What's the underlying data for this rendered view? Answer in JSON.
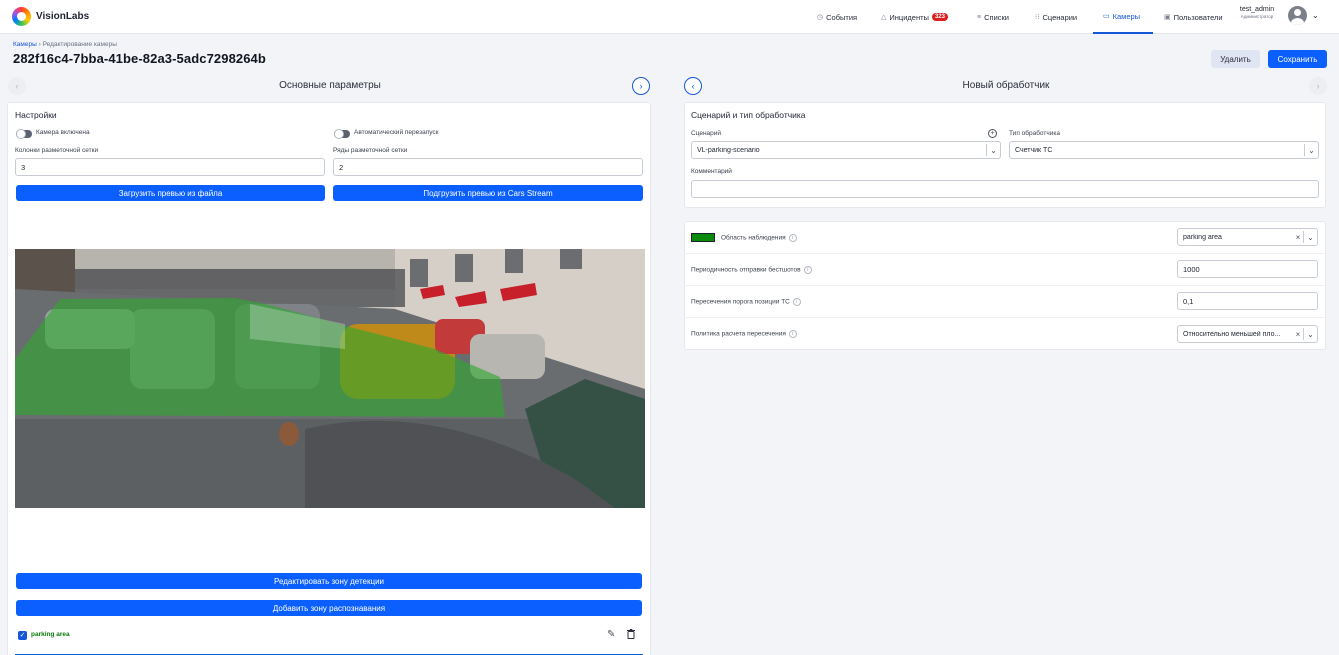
{
  "app": {
    "name": "VisionLabs"
  },
  "nav": {
    "events": "События",
    "incidents": "Инциденты",
    "incidents_count": "323",
    "lists": "Списки",
    "scenarios": "Сценарии",
    "cameras": "Камеры",
    "users": "Пользователи"
  },
  "user": {
    "name": "test_admin",
    "role": "Администратор"
  },
  "breadcrumb": {
    "root": "Камеры",
    "sep": "›",
    "current": "Редактирование камеры"
  },
  "page": {
    "title": "282f16c4-7bba-41be-82a3-5adc7298264b"
  },
  "actions": {
    "delete": "Удалить",
    "save": "Сохранить"
  },
  "left": {
    "title": "Основные параметры",
    "settings_title": "Настройки",
    "camera_enabled": "Камера включена",
    "auto_restart": "Автоматический перезапуск",
    "grid_cols_label": "Колонки разметочной сетки",
    "grid_cols_value": "3",
    "grid_rows_label": "Ряды разметочной сетки",
    "grid_rows_value": "2",
    "load_preview_file": "Загрузить превью из файла",
    "load_preview_stream": "Подгрузить превью из Cars Stream",
    "edit_detection_zone": "Редактировать зону детекции",
    "add_recognition_zone": "Добавить зону распознавания",
    "zone_name": "parking area"
  },
  "right": {
    "title": "Новый обработчик",
    "section_title": "Сценарий и тип обработчика",
    "scenario_label": "Сценарий",
    "scenario_value": "VL-parking-scenario",
    "handler_type_label": "Тип обработчика",
    "handler_type_value": "Счетчик ТС",
    "comment_label": "Комментарий",
    "comment_value": "",
    "observation_area_label": "Область наблюдения",
    "observation_area_value": "parking area",
    "observation_color": "#0a8a0a",
    "bestshot_period_label": "Периодичность отправки бестшотов",
    "bestshot_period_value": "1000",
    "position_threshold_label": "Пересечения порога позиции ТС",
    "position_threshold_value": "0,1",
    "intersection_policy_label": "Политика расчета пересечения",
    "intersection_policy_value": "Относительно меньшей пло..."
  },
  "colors": {
    "accent": "#0b5fff",
    "zone": "#2ea82e"
  }
}
